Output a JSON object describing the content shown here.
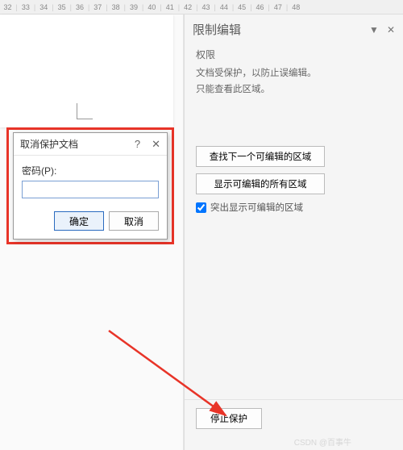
{
  "ruler": [
    "32",
    "33",
    "34",
    "35",
    "36",
    "37",
    "38",
    "39",
    "40",
    "41",
    "42",
    "43",
    "44",
    "45",
    "46",
    "47",
    "48"
  ],
  "dialog": {
    "title": "取消保护文档",
    "help_icon": "?",
    "close_icon": "✕",
    "password_label": "密码(P):",
    "password_value": "",
    "ok_label": "确定",
    "cancel_label": "取消"
  },
  "panel": {
    "title": "限制编辑",
    "dropdown_icon": "▼",
    "close_icon": "✕",
    "section_head": "权限",
    "info_line1": "文档受保护，以防止误编辑。",
    "info_line2": "只能查看此区域。",
    "btn_find_next": "查找下一个可编辑的区域",
    "btn_show_all": "显示可编辑的所有区域",
    "chk_highlight": "突出显示可编辑的区域",
    "chk_checked": true,
    "btn_stop": "停止保护"
  },
  "watermark": "CSDN @百事牛"
}
